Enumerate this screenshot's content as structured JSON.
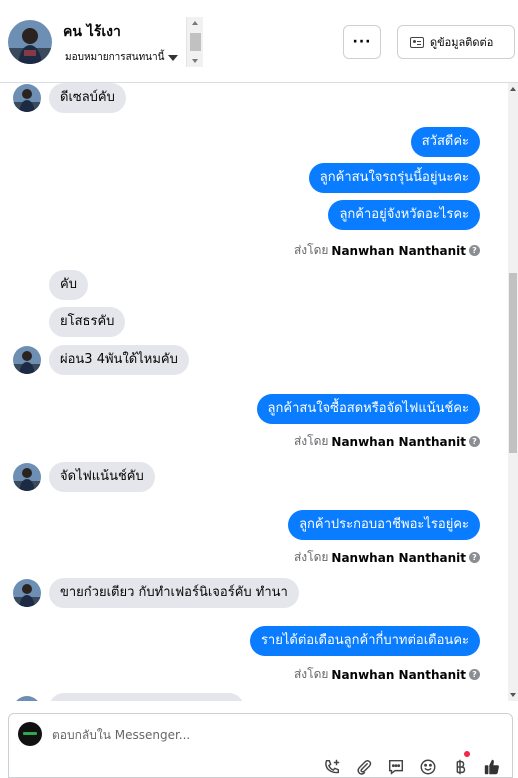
{
  "header": {
    "customer_name": "คน ไร้เงา",
    "assign_label": "มอบหมายการสนทนานี้",
    "more_label": "···",
    "contact_label": "ดูข้อมูลติดต่อ"
  },
  "messages": [
    {
      "dir": "in",
      "text": "ดีเซลบ์คับ",
      "avatar": true
    },
    {
      "dir": "out",
      "text": "สวัสดีค่ะ"
    },
    {
      "dir": "out",
      "text": "ลูกค้าสนใจรถรุ่นนี้อยู่นะคะ"
    },
    {
      "dir": "out",
      "text": "ลูกค้าอยู่จังหวัดอะไรคะ"
    },
    {
      "dir": "in",
      "text": "คับ"
    },
    {
      "dir": "in",
      "text": "ยโสธรคับ"
    },
    {
      "dir": "in",
      "text": "ผ่อน3  4พันใด้ไหมคับ",
      "avatar": true
    },
    {
      "dir": "out",
      "text": "ลูกค้าสนใจซื้อสดหรือจัดไฟแน้นช์คะ"
    },
    {
      "dir": "in",
      "text": "จัดไฟแน้นช์คับ",
      "avatar": true
    },
    {
      "dir": "out",
      "text": "ลูกค้าประกอบอาชีพอะไรอยู่คะ"
    },
    {
      "dir": "in",
      "text": "ขายก๋วยเตียว  กับทำเฟอร์นิเจอร์คับ ทำนา",
      "avatar": true
    },
    {
      "dir": "out",
      "text": "รายได้ต่อเดือนลูกค้ากี่บาทต่อเดือนคะ"
    }
  ],
  "sent_by": {
    "prefix": "ส่งโดย",
    "name": "Nanwhan Nanthanit",
    "help_icon": "question-circle-icon"
  },
  "composer": {
    "placeholder": "ตอบกลับใน Messenger...",
    "tools": [
      "add-contact-icon",
      "attachment-icon",
      "saved-reply-icon",
      "emoji-icon",
      "baht-icon",
      "thumbs-up-icon"
    ]
  },
  "colors": {
    "outgoing_bubble": "#0a7cff",
    "incoming_bubble": "#e4e6eb",
    "notification_dot": "#f02849"
  }
}
